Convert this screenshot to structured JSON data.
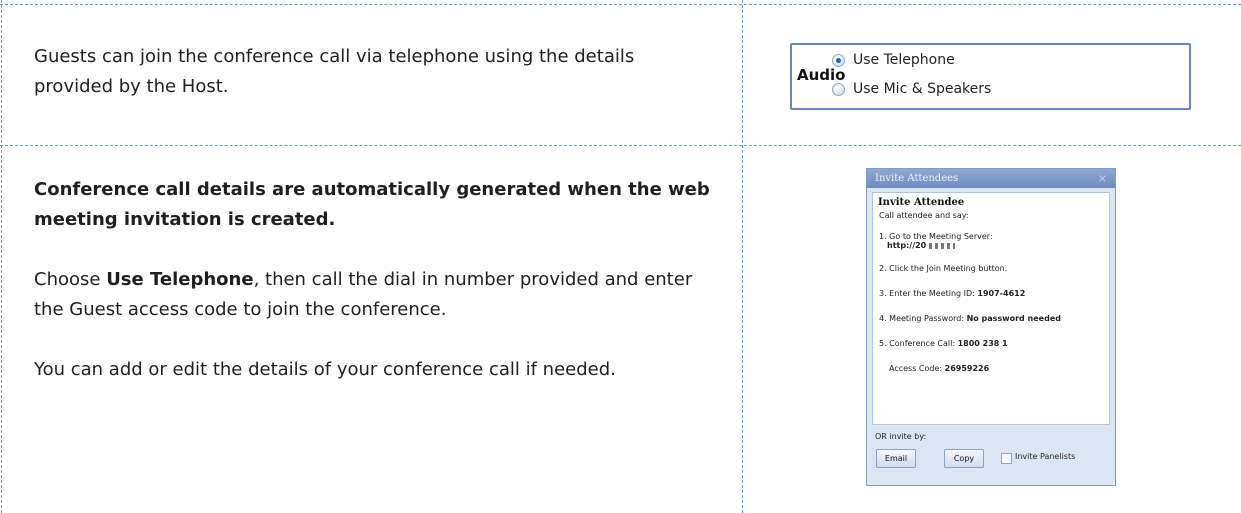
{
  "row1": {
    "text": "Guests can join the conference call via telephone using the details provided by the Host."
  },
  "audio_panel": {
    "label": "Audio",
    "options": [
      {
        "label": "Use Telephone",
        "selected": true
      },
      {
        "label": "Use Mic & Speakers",
        "selected": false
      }
    ]
  },
  "row2": {
    "heading": "Conference call details are automatically generated when the web meeting invitation is created.",
    "para2_prefix": "Choose ",
    "para2_bold": "Use Telephone",
    "para2_suffix": ", then call the dial in number provided and enter the Guest access code to join the conference.",
    "para3": "You can add or edit the details of your conference call if needed."
  },
  "dialog": {
    "title": "Invite Attendees",
    "close": "×",
    "heading": "Invite Attendee",
    "intro": "Call attendee and say:",
    "step1": "1. Go to the Meeting Server:",
    "server_url": "http://20",
    "step2": "2. Click the Join Meeting button.",
    "step3_label": "3. Enter the Meeting ID: ",
    "meeting_id": "1907-4612",
    "step4_label": "4. Meeting Password: ",
    "password": "No password needed",
    "step5_label": "5. Conference Call: ",
    "conference_number": "1800 238 1",
    "access_label": "Access Code: ",
    "access_code": "26959226",
    "or_invite": "OR invite by:",
    "email_button": "Email",
    "copy_button": "Copy",
    "invite_panelists": "Invite Panelists"
  }
}
